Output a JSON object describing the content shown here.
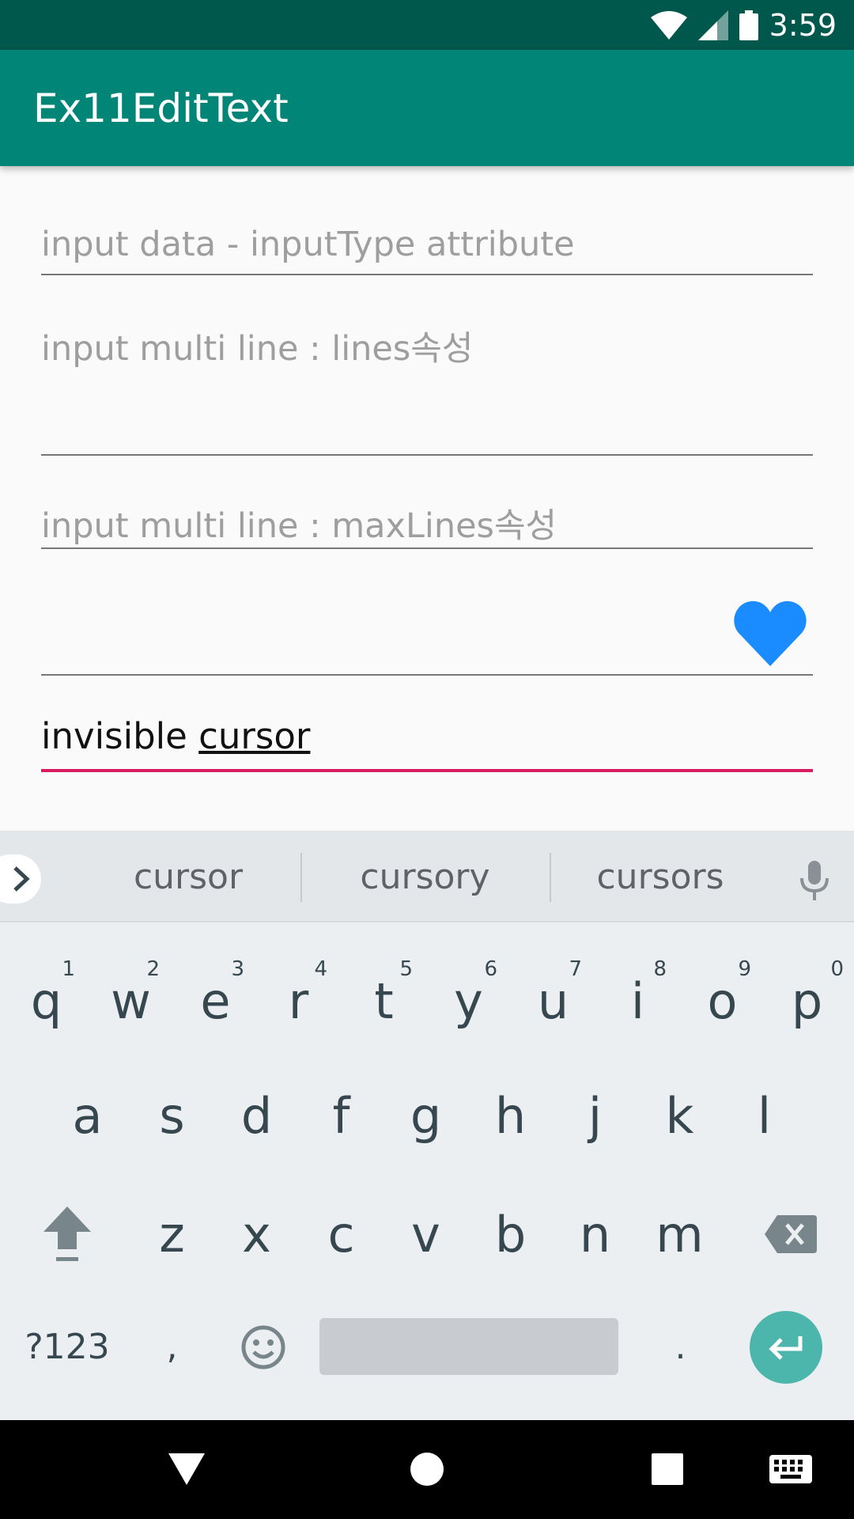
{
  "status_bar": {
    "time": "3:59",
    "icons": [
      "wifi-icon",
      "signal-icon",
      "battery-icon"
    ]
  },
  "app_bar": {
    "title": "Ex11EditText"
  },
  "fields": {
    "input_type_hint": "input data - inputType attribute",
    "lines_hint": "input multi line : lines속성",
    "max_lines_hint": "input multi line : maxLines속성",
    "drawable_field_icon": "heart-icon",
    "cursor_field_text_plain": "invisible ",
    "cursor_field_text_underlined": "cursor"
  },
  "keyboard": {
    "suggestions": [
      "cursor",
      "cursory",
      "cursors"
    ],
    "row1": [
      "q",
      "w",
      "e",
      "r",
      "t",
      "y",
      "u",
      "i",
      "o",
      "p"
    ],
    "row1_hints": [
      "1",
      "2",
      "3",
      "4",
      "5",
      "6",
      "7",
      "8",
      "9",
      "0"
    ],
    "row2": [
      "a",
      "s",
      "d",
      "f",
      "g",
      "h",
      "j",
      "k",
      "l"
    ],
    "row3": [
      "z",
      "x",
      "c",
      "v",
      "b",
      "n",
      "m"
    ],
    "symbols_label": "?123",
    "comma_label": ",",
    "period_label": "."
  },
  "colors": {
    "status_bar": "#00574b",
    "app_bar": "#008577",
    "accent": "#d81b60",
    "heart": "#1a8cff",
    "enter_key": "#4db6ac"
  }
}
